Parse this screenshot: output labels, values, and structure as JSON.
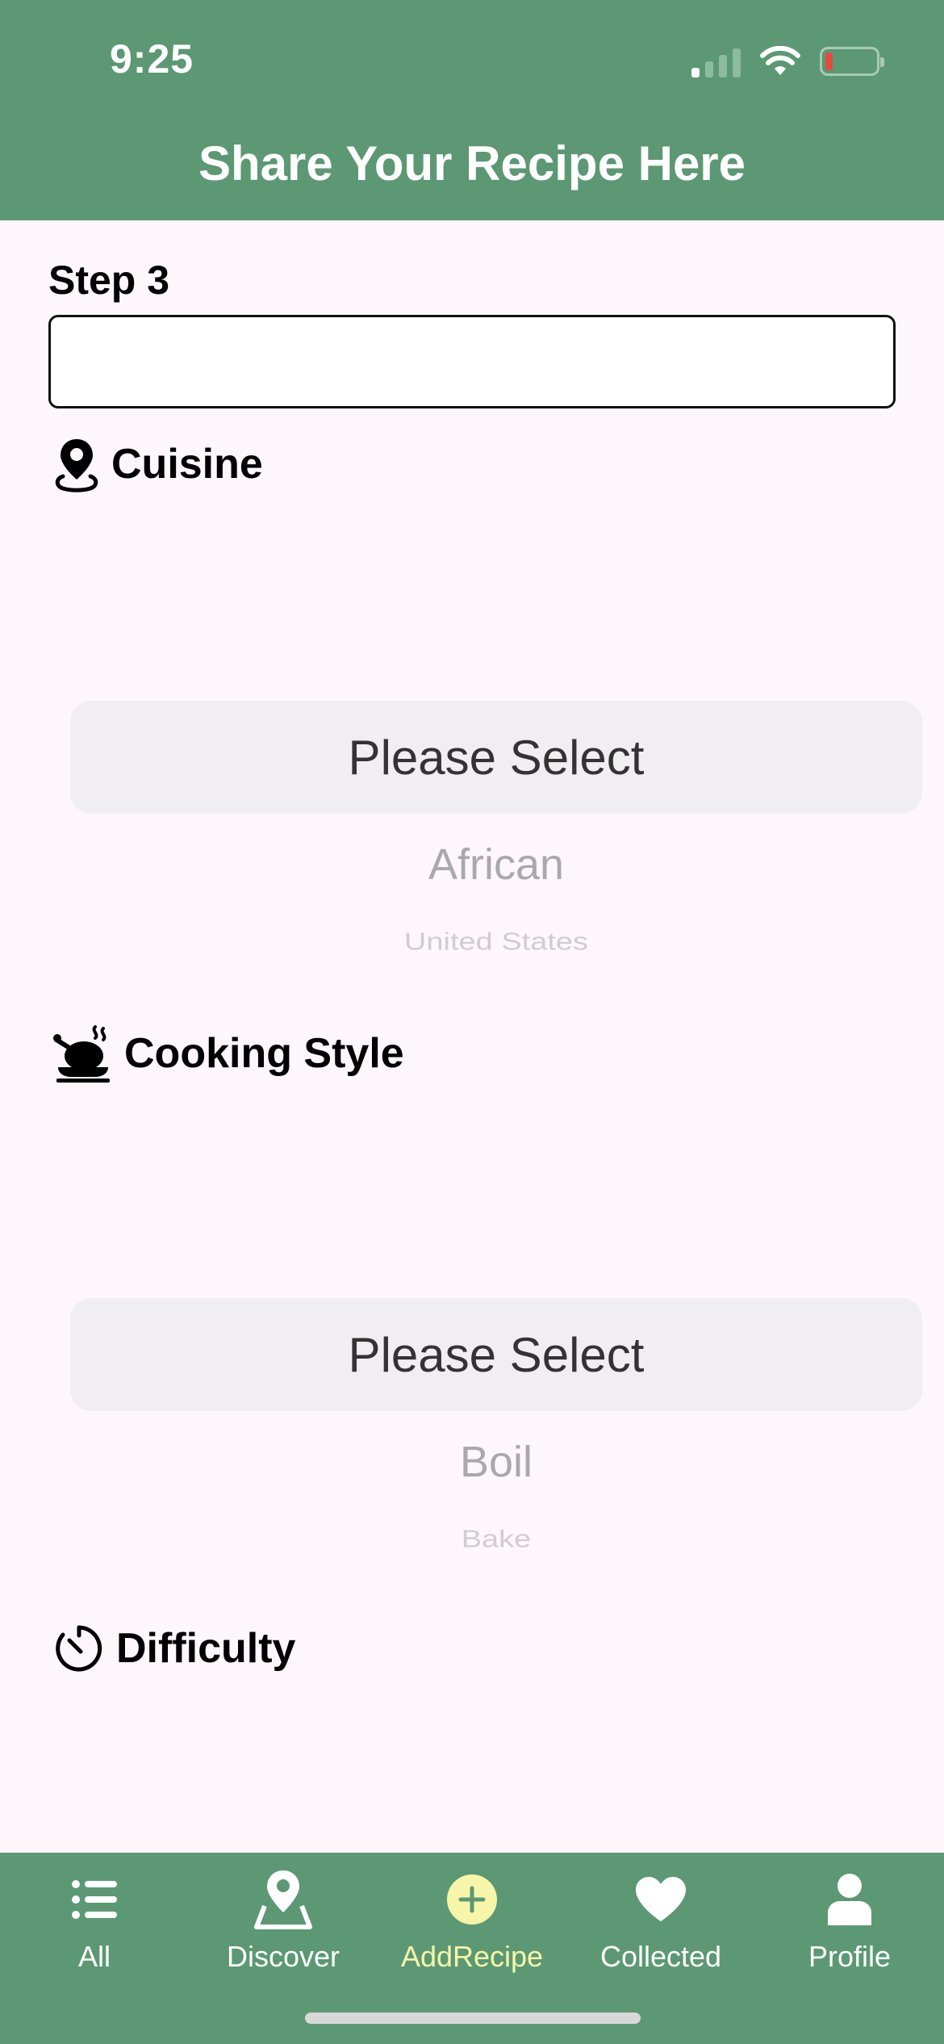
{
  "status_bar": {
    "time": "9:25",
    "signal_icon": "cellular-signal-icon",
    "wifi_icon": "wifi-icon",
    "battery_icon": "battery-low-icon"
  },
  "header": {
    "title": "Share Your Recipe Here"
  },
  "step": {
    "label": "Step 3",
    "value": "",
    "placeholder": ""
  },
  "cuisine": {
    "icon": "map-pin-icon",
    "label": "Cuisine",
    "picker": {
      "selected": "Please Select",
      "options": [
        "African",
        "United States"
      ]
    }
  },
  "cooking_style": {
    "icon": "roast-chicken-icon",
    "label": "Cooking Style",
    "picker": {
      "selected": "Please Select",
      "options": [
        "Boil",
        "Bake"
      ]
    }
  },
  "difficulty": {
    "icon": "timer-icon",
    "label": "Difficulty"
  },
  "tabbar": {
    "active_color": "#f6f5a9",
    "background": "#5c9873",
    "tabs": [
      {
        "label": "All",
        "icon": "list-icon"
      },
      {
        "label": "Discover",
        "icon": "location-icon"
      },
      {
        "label": "AddRecipe",
        "icon": "plus-circle-icon"
      },
      {
        "label": "Collected",
        "icon": "heart-icon"
      },
      {
        "label": "Profile",
        "icon": "person-icon"
      }
    ]
  }
}
